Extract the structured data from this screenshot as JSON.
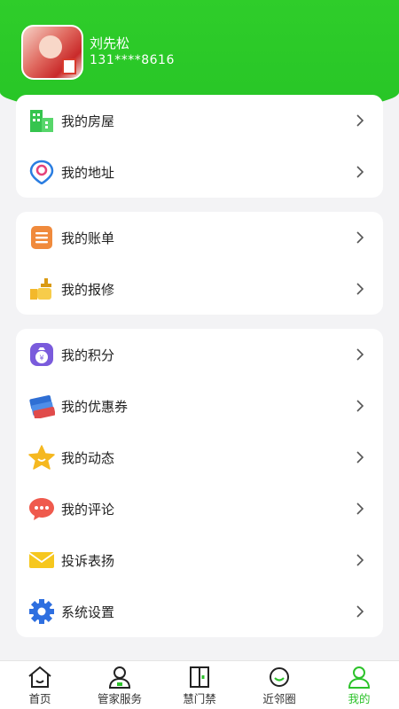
{
  "profile": {
    "name": "刘先松",
    "phone": "131****8616"
  },
  "groups": [
    {
      "items": [
        {
          "label": "我的房屋",
          "icon": "building-icon",
          "color": "#35c44e"
        },
        {
          "label": "我的地址",
          "icon": "location-pin-icon",
          "color": "#2a7de1"
        }
      ]
    },
    {
      "items": [
        {
          "label": "我的账单",
          "icon": "bill-icon",
          "color": "#f08a3c"
        },
        {
          "label": "我的报修",
          "icon": "repair-icon",
          "color": "#f3b82b"
        }
      ]
    },
    {
      "items": [
        {
          "label": "我的积分",
          "icon": "points-bag-icon",
          "color": "#7a5bdc"
        },
        {
          "label": "我的优惠券",
          "icon": "coupon-icon",
          "color": "#2f6fd4"
        },
        {
          "label": "我的动态",
          "icon": "star-icon",
          "color": "#f5b820"
        },
        {
          "label": "我的评论",
          "icon": "comment-icon",
          "color": "#ef5a4d"
        },
        {
          "label": "投诉表扬",
          "icon": "envelope-icon",
          "color": "#f6c71e"
        },
        {
          "label": "系统设置",
          "icon": "gear-icon",
          "color": "#2e6fe0"
        }
      ]
    }
  ],
  "tabs": [
    {
      "label": "首页",
      "icon": "home-icon",
      "active": false
    },
    {
      "label": "管家服务",
      "icon": "butler-icon",
      "active": false
    },
    {
      "label": "慧门禁",
      "icon": "door-icon",
      "active": false
    },
    {
      "label": "近邻圈",
      "icon": "neighbor-circle-icon",
      "active": false
    },
    {
      "label": "我的",
      "icon": "person-icon",
      "active": true
    }
  ],
  "colors": {
    "brand_green": "#2cc22a",
    "background": "#f3f3f5"
  }
}
